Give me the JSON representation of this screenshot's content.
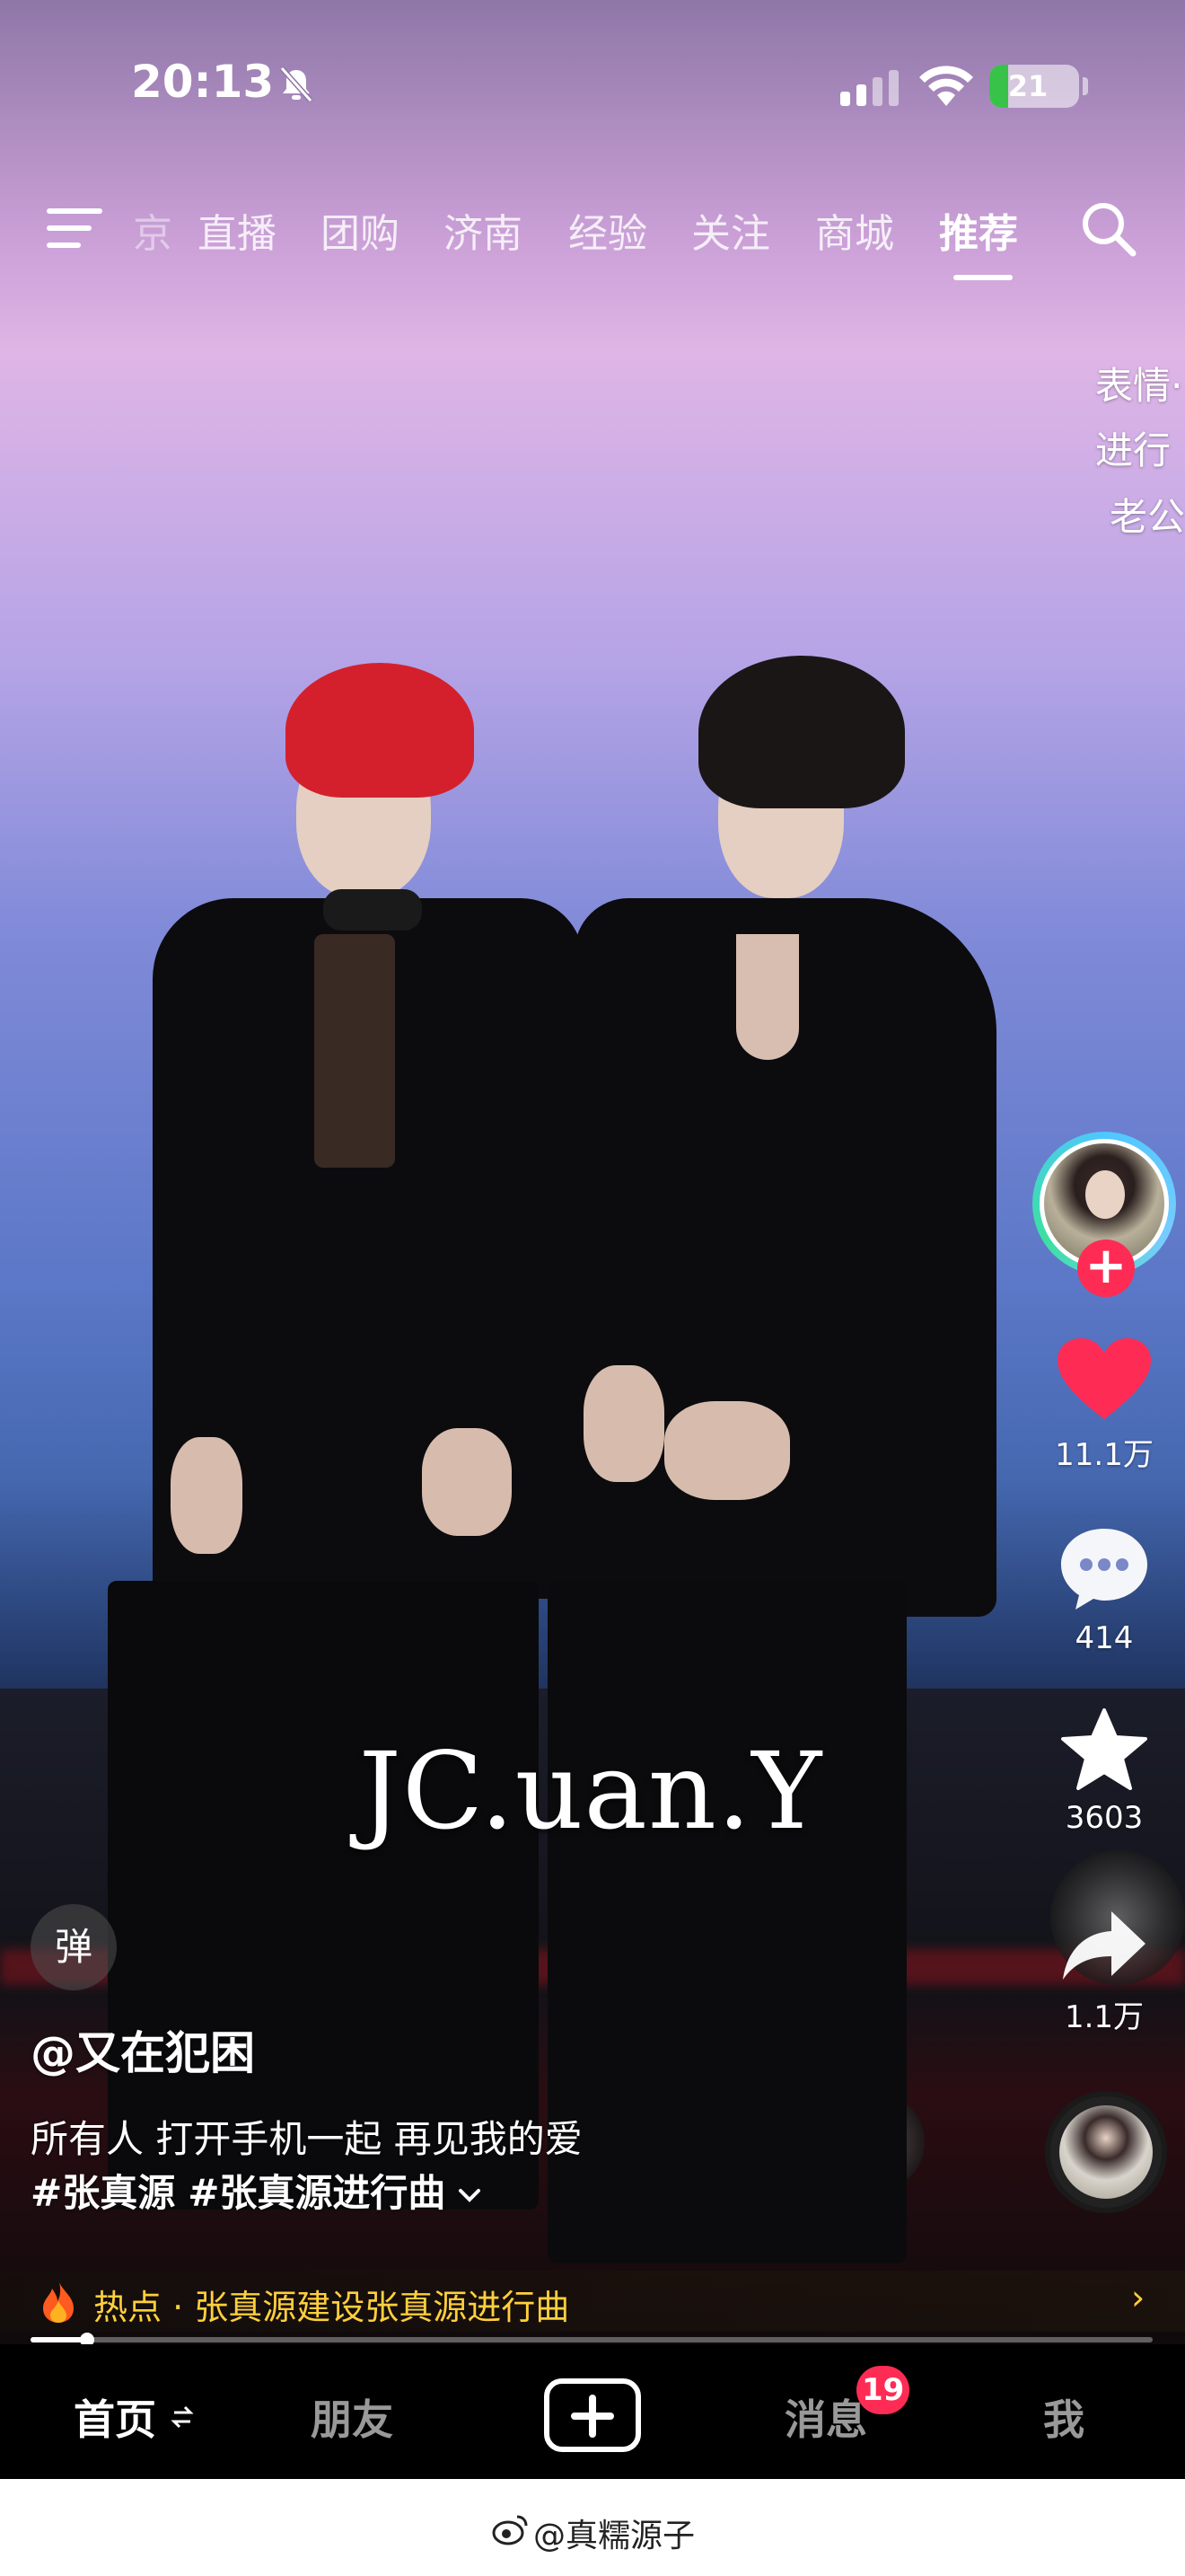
{
  "status_bar": {
    "time": "20:13",
    "battery": "21",
    "battery_level": 0.21
  },
  "top_tabs": [
    {
      "label": "京"
    },
    {
      "label": "直播"
    },
    {
      "label": "团购"
    },
    {
      "label": "济南"
    },
    {
      "label": "经验"
    },
    {
      "label": "关注"
    },
    {
      "label": "商城"
    },
    {
      "label": "推荐"
    }
  ],
  "active_tab": "推荐",
  "danmaku": [
    "表情·",
    "进行",
    "老公"
  ],
  "video": {
    "overlay_text": "JC.uan.Y"
  },
  "actions": {
    "likes": "11.1万",
    "comments": "414",
    "favorites": "3603",
    "shares": "1.1万"
  },
  "danmu_toggle": "弹",
  "post": {
    "author": "@又在犯困",
    "description": "所有人 打开手机一起 再见我的爱",
    "tags": [
      "#张真源",
      "#张真源进行曲"
    ],
    "expand_icon": "chevron-down"
  },
  "hot": {
    "text": "热点 · 张真源建设张真源进行曲",
    "arrow": "›"
  },
  "progress": 0.05,
  "bottom_nav": {
    "home": "首页",
    "friends": "朋友",
    "messages": "消息",
    "messages_badge": "19",
    "me": "我"
  },
  "footer": {
    "weibo_handle": "@真糯源子"
  },
  "colors": {
    "accent": "#fe2c55",
    "hot": "#ffcf3d",
    "ring": "#4fc7ff"
  }
}
